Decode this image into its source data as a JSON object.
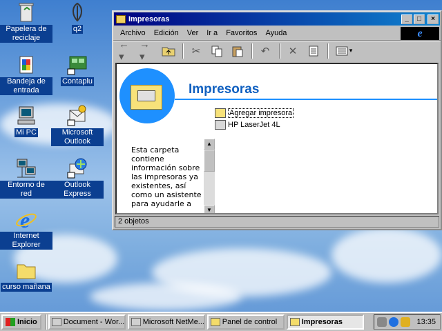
{
  "desktop": {
    "icons": [
      {
        "label": "Papelera de reciclaje",
        "icon": "recycle-bin-icon"
      },
      {
        "label": "q2",
        "icon": "quake-icon"
      },
      {
        "label": "Bandeja de entrada",
        "icon": "inbox-icon"
      },
      {
        "label": "Contaplu",
        "icon": "contaplu-icon"
      },
      {
        "label": "Mi PC",
        "icon": "computer-icon"
      },
      {
        "label": "Microsoft Outlook",
        "icon": "outlook-icon"
      },
      {
        "label": "Entorno de red",
        "icon": "network-icon"
      },
      {
        "label": "Outlook Express",
        "icon": "outlook-express-icon"
      },
      {
        "label": "Internet Explorer",
        "icon": "internet-explorer-icon"
      },
      {
        "label": "curso mañana",
        "icon": "folder-icon"
      }
    ]
  },
  "window": {
    "title": "Impresoras",
    "menu": [
      "Archivo",
      "Edición",
      "Ver",
      "Ir a",
      "Favoritos",
      "Ayuda"
    ],
    "toolbar": [
      "back-icon",
      "forward-icon",
      "up-folder-icon",
      "cut-icon",
      "copy-icon",
      "paste-icon",
      "undo-icon",
      "delete-icon",
      "properties-icon",
      "views-icon"
    ],
    "content": {
      "heading": "Impresoras",
      "description": "Esta carpeta contiene información sobre las impresoras ya existentes, así como un asistente para ayudarle a",
      "items": [
        {
          "label": "Agregar impresora",
          "icon": "add-printer-icon"
        },
        {
          "label": "HP LaserJet 4L",
          "icon": "printer-icon"
        }
      ]
    },
    "status": "2 objetos"
  },
  "taskbar": {
    "start_label": "Inicio",
    "tasks": [
      {
        "label": "Document - Wor...",
        "active": false
      },
      {
        "label": "Microsoft NetMe...",
        "active": false
      },
      {
        "label": "Panel de control",
        "active": false
      },
      {
        "label": "Impresoras",
        "active": true
      }
    ],
    "clock": "13:35"
  },
  "colors": {
    "titlebar_start": "#000080",
    "titlebar_end": "#1084d0",
    "heading": "#1060c0",
    "badge": "#1e90ff"
  }
}
